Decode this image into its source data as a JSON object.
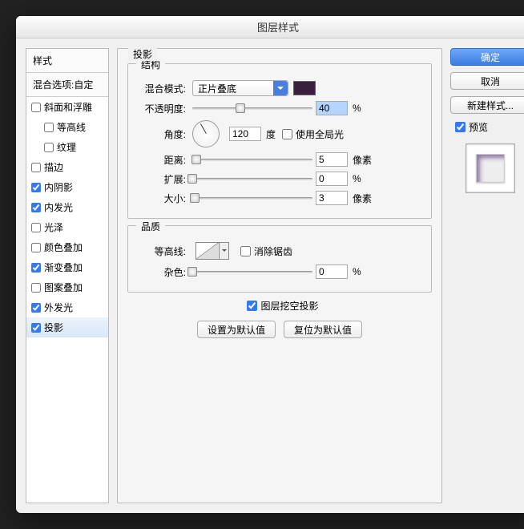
{
  "title": "图层样式",
  "sidebar": {
    "header": "样式",
    "blend_header": "混合选项:自定",
    "items": [
      {
        "label": "斜面和浮雕",
        "checked": false,
        "indent": 0
      },
      {
        "label": "等高线",
        "checked": false,
        "indent": 1
      },
      {
        "label": "纹理",
        "checked": false,
        "indent": 1
      },
      {
        "label": "描边",
        "checked": false,
        "indent": 0
      },
      {
        "label": "内阴影",
        "checked": true,
        "indent": 0
      },
      {
        "label": "内发光",
        "checked": true,
        "indent": 0
      },
      {
        "label": "光泽",
        "checked": false,
        "indent": 0
      },
      {
        "label": "颜色叠加",
        "checked": false,
        "indent": 0
      },
      {
        "label": "渐变叠加",
        "checked": true,
        "indent": 0
      },
      {
        "label": "图案叠加",
        "checked": false,
        "indent": 0
      },
      {
        "label": "外发光",
        "checked": true,
        "indent": 0
      },
      {
        "label": "投影",
        "checked": true,
        "indent": 0,
        "selected": true
      }
    ]
  },
  "main": {
    "tab": "投影",
    "structure": {
      "legend": "结构",
      "blend_mode_label": "混合模式:",
      "blend_mode_value": "正片叠底",
      "color": "#3a1f3e",
      "opacity_label": "不透明度:",
      "opacity_value": "40",
      "opacity_unit": "%",
      "angle_label": "角度:",
      "angle_value": "120",
      "angle_unit": "度",
      "global_light_label": "使用全局光",
      "global_light_checked": false,
      "distance_label": "距离:",
      "distance_value": "5",
      "distance_unit": "像素",
      "spread_label": "扩展:",
      "spread_value": "0",
      "spread_unit": "%",
      "size_label": "大小:",
      "size_value": "3",
      "size_unit": "像素"
    },
    "quality": {
      "legend": "品质",
      "contour_label": "等高线:",
      "antialias_label": "消除锯齿",
      "antialias_checked": false,
      "noise_label": "杂色:",
      "noise_value": "0",
      "noise_unit": "%"
    },
    "knockout_label": "图层挖空投影",
    "knockout_checked": true,
    "default_btn": "设置为默认值",
    "reset_btn": "复位为默认值"
  },
  "right": {
    "ok": "确定",
    "cancel": "取消",
    "new_style": "新建样式...",
    "preview_label": "预览",
    "preview_checked": true
  }
}
